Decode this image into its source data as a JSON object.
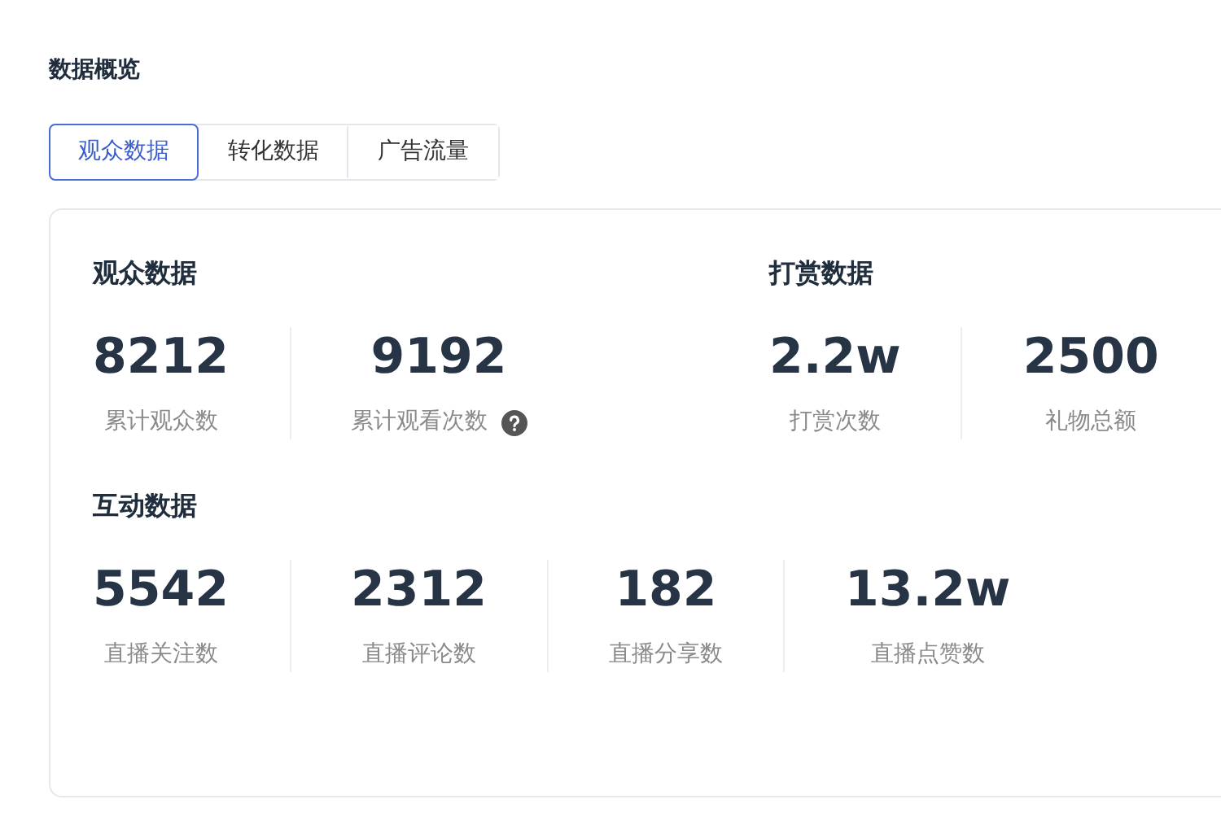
{
  "page_title": "数据概览",
  "tabs": [
    {
      "label": "观众数据",
      "selected": true
    },
    {
      "label": "转化数据",
      "selected": false
    },
    {
      "label": "广告流量",
      "selected": false
    }
  ],
  "sections": [
    {
      "title": "观众数据",
      "stats": [
        {
          "value": "8212",
          "label": "累计观众数"
        },
        {
          "value": "9192",
          "label": "累计观看次数",
          "help_icon": true
        }
      ]
    },
    {
      "title": "打赏数据",
      "stats": [
        {
          "value": "2.2w",
          "label": "打赏次数"
        },
        {
          "value": "2500",
          "label": "礼物总额"
        }
      ]
    },
    {
      "title": "互动数据",
      "stats": [
        {
          "value": "5542",
          "label": "直播关注数"
        },
        {
          "value": "2312",
          "label": "直播评论数"
        },
        {
          "value": "182",
          "label": "直播分享数"
        },
        {
          "value": "13.2w",
          "label": "直播点赞数"
        }
      ]
    }
  ]
}
